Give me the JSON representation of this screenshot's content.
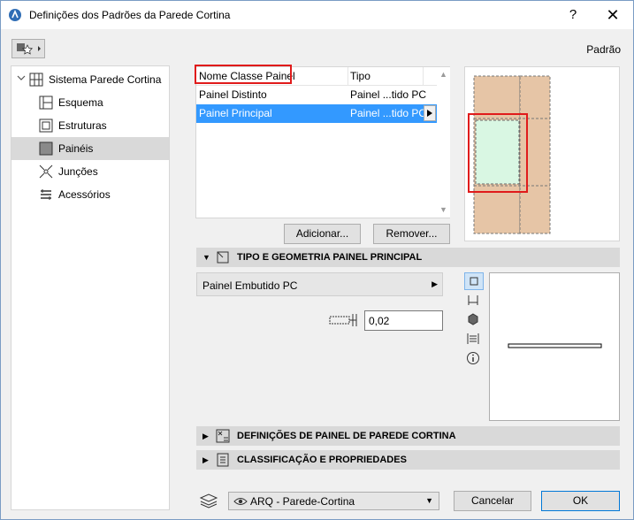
{
  "window": {
    "title": "Definições dos Padrões da Parede Cortina",
    "help": "?",
    "close": "✕"
  },
  "header": {
    "default_label": "Padrão"
  },
  "sidebar": {
    "root": "Sistema Parede Cortina",
    "items": [
      {
        "label": "Esquema",
        "icon": "scheme-icon"
      },
      {
        "label": "Estruturas",
        "icon": "frames-icon"
      },
      {
        "label": "Painéis",
        "icon": "panels-icon",
        "selected": true
      },
      {
        "label": "Junções",
        "icon": "junctions-icon"
      },
      {
        "label": "Acessórios",
        "icon": "accessories-icon"
      }
    ]
  },
  "panel_list": {
    "columns": [
      "Nome Classe Painel",
      "Tipo"
    ],
    "rows": [
      {
        "name": "Painel Distinto",
        "type": "Painel ...tido PC",
        "selected": false
      },
      {
        "name": "Painel Principal",
        "type": "Painel ...tido PC",
        "selected": true
      }
    ]
  },
  "buttons": {
    "add": "Adicionar...",
    "remove": "Remover...",
    "cancel": "Cancelar",
    "ok": "OK"
  },
  "sections": {
    "type_geometry": "TIPO E GEOMETRIA PAINEL PRINCIPAL",
    "panel_settings": "DEFINIÇÕES DE PAINEL DE PAREDE CORTINA",
    "classification": "CLASSIFICAÇÃO E PROPRIEDADES"
  },
  "geometry": {
    "panel_type": "Painel Embutido PC",
    "thickness_value": "0,02"
  },
  "footer": {
    "view": "ARQ - Parede-Cortina"
  },
  "colors": {
    "selection": "#3399ff",
    "highlight": "#e01b1b",
    "panel_fill": "#e6c5a6",
    "glass_fill": "#d9f7e3"
  }
}
